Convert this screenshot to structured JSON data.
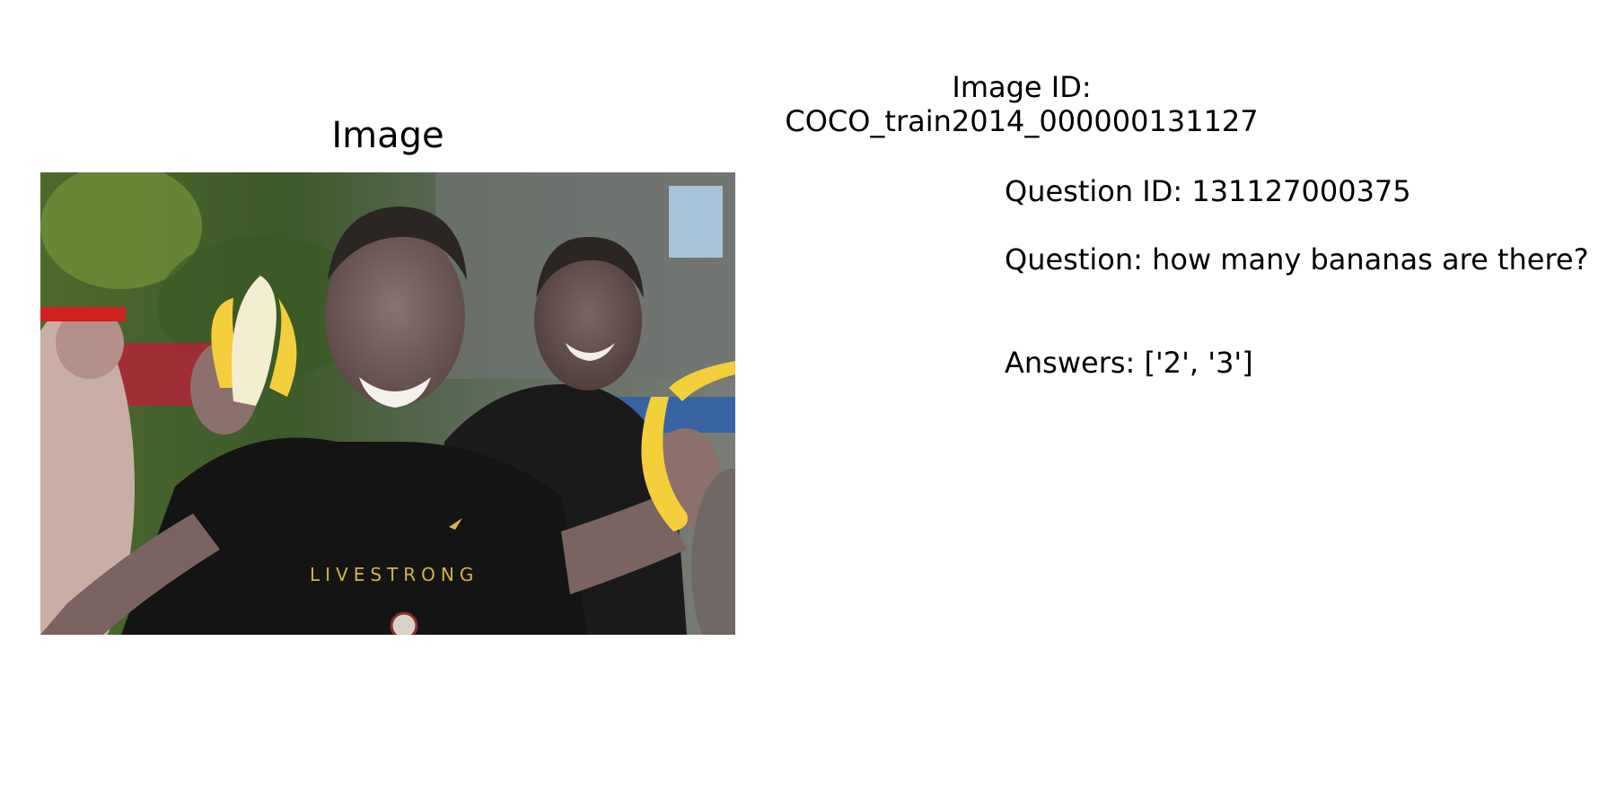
{
  "panel": {
    "title": "Image"
  },
  "photo": {
    "shirt_text": "LIVESTRONG"
  },
  "info": {
    "image_id_label": "Image ID:",
    "image_id_value": "COCO_train2014_000000131127",
    "question_id": "Question ID: 131127000375",
    "question": "Question: how many bananas are there?",
    "answers": "Answers: ['2', '3']"
  },
  "colors": {
    "background": "#ffffff",
    "text": "#000000",
    "banana": "#f2cf3b",
    "shirt": "#141414"
  }
}
